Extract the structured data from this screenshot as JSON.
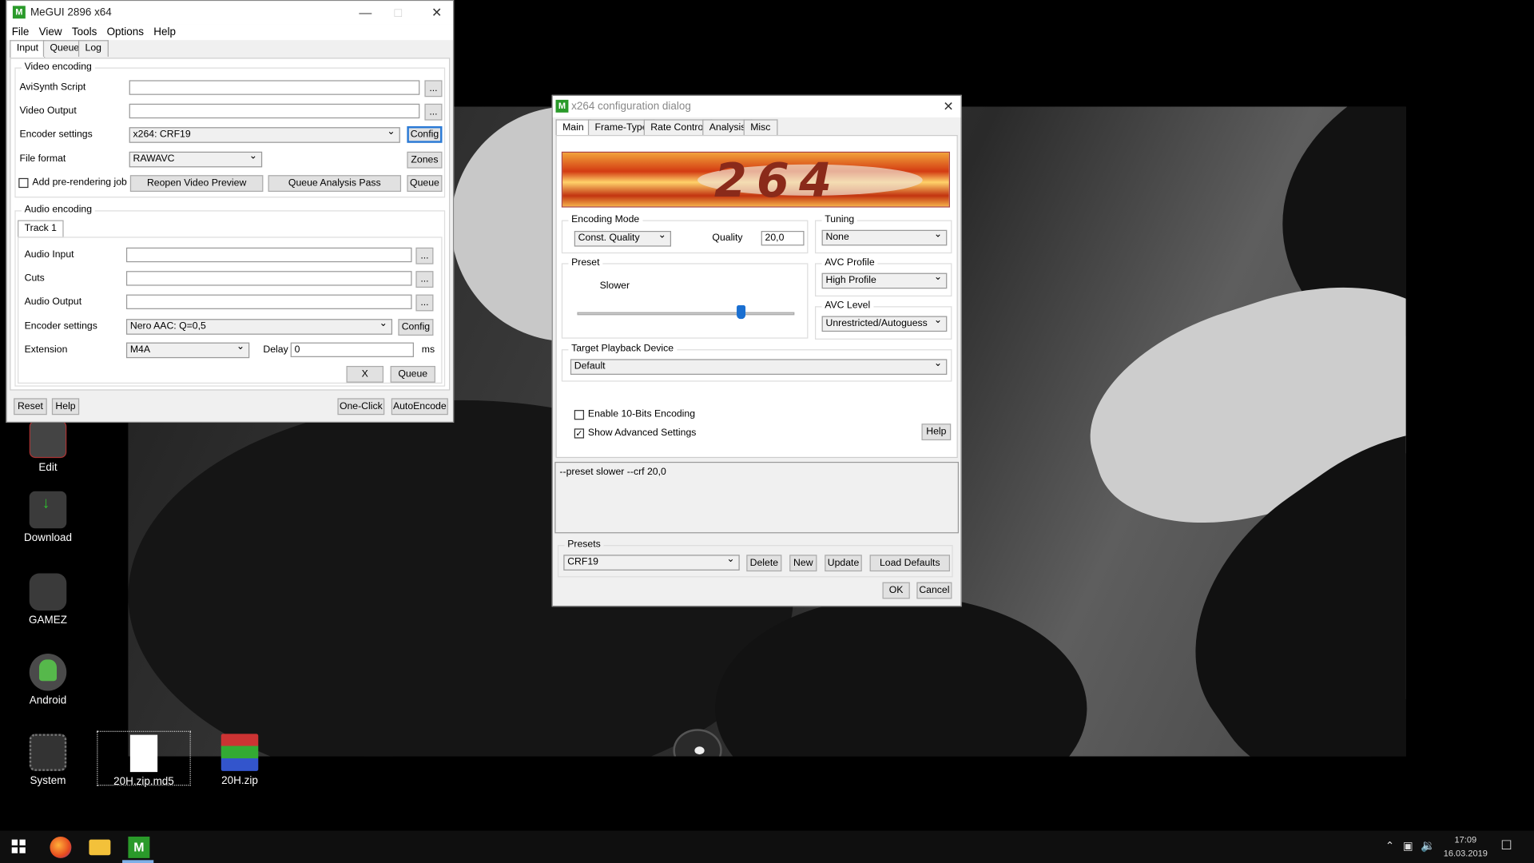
{
  "desktop": {
    "icons": [
      {
        "label": "Edit",
        "icon": "edit-icon"
      },
      {
        "label": "Download",
        "icon": "download-icon"
      },
      {
        "label": "GAMEZ",
        "icon": "gamez-icon"
      },
      {
        "label": "Android",
        "icon": "android-icon"
      },
      {
        "label": "System",
        "icon": "system-icon"
      },
      {
        "label": "20H.zip.md5",
        "icon": "file-icon"
      },
      {
        "label": "20H.zip",
        "icon": "winrar-icon"
      }
    ]
  },
  "megui": {
    "title": "MeGUI 2896 x64",
    "menu": [
      "File",
      "View",
      "Tools",
      "Options",
      "Help"
    ],
    "tabs": [
      "Input",
      "Queue",
      "Log"
    ],
    "video": {
      "group": "Video encoding",
      "avisynth_label": "AviSynth Script",
      "avisynth_value": "",
      "output_label": "Video Output",
      "output_value": "",
      "enc_label": "Encoder settings",
      "enc_value": "x264: CRF19",
      "config": "Config",
      "format_label": "File format",
      "format_value": "RAWAVC",
      "zones": "Zones",
      "prerender": "Add pre-rendering job",
      "reopen": "Reopen Video Preview",
      "analysis": "Queue Analysis Pass",
      "queue": "Queue",
      "browse": "..."
    },
    "audio": {
      "group": "Audio encoding",
      "track": "Track 1",
      "input_label": "Audio Input",
      "cuts_label": "Cuts",
      "output_label": "Audio Output",
      "enc_label": "Encoder settings",
      "enc_value": "Nero AAC: Q=0,5",
      "config": "Config",
      "ext_label": "Extension",
      "ext_value": "M4A",
      "delay_label": "Delay",
      "delay_value": "0",
      "ms": "ms",
      "x": "X",
      "queue": "Queue",
      "browse": "..."
    },
    "bottom": {
      "reset": "Reset",
      "help": "Help",
      "oneclick": "One-Click",
      "autoencode": "AutoEncode"
    }
  },
  "x264": {
    "title": "x264 configuration dialog",
    "tabs": [
      "Main",
      "Frame-Type",
      "Rate Control",
      "Analysis",
      "Misc"
    ],
    "banner": "264",
    "encoding_mode_label": "Encoding Mode",
    "encoding_mode": "Const. Quality",
    "quality_label": "Quality",
    "quality": "20,0",
    "tuning_label": "Tuning",
    "tuning": "None",
    "preset_label": "Preset",
    "preset_value": "Slower",
    "preset_level": 0.75,
    "profile_label": "AVC Profile",
    "profile": "High Profile",
    "level_label": "AVC Level",
    "level": "Unrestricted/Autoguess",
    "device_label": "Target Playback Device",
    "device": "Default",
    "tenbit": "Enable 10-Bits Encoding",
    "advanced": "Show Advanced Settings",
    "help": "Help",
    "cmdline": "--preset slower --crf 20,0",
    "presets_label": "Presets",
    "preset_sel": "CRF19",
    "delete": "Delete",
    "new": "New",
    "update": "Update",
    "load": "Load Defaults",
    "ok": "OK",
    "cancel": "Cancel"
  },
  "taskbar": {
    "time": "17:09",
    "date": "16.03.2019"
  }
}
